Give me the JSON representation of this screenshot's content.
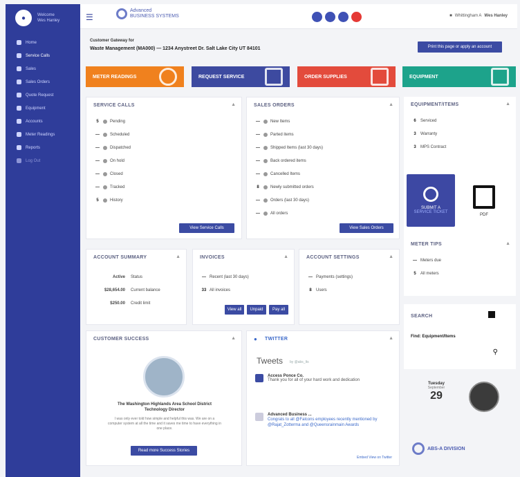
{
  "sidebar": {
    "user_line1": "Welcome",
    "user_line2": "Wes Hanley",
    "items": [
      {
        "label": "Home",
        "icon": "home-icon"
      },
      {
        "label": "Service Calls",
        "icon": "wrench-icon"
      },
      {
        "label": "Sales",
        "icon": "cart-icon"
      },
      {
        "label": "Sales Orders",
        "icon": "list-icon"
      },
      {
        "label": "Quote Request",
        "icon": "quote-icon"
      },
      {
        "label": "Equipment",
        "icon": "gear-icon"
      },
      {
        "label": "Accounts",
        "icon": "account-icon"
      },
      {
        "label": "Meter Readings",
        "icon": "meter-icon"
      },
      {
        "label": "Reports",
        "icon": "report-icon"
      },
      {
        "label": "Log Out",
        "icon": "logout-icon"
      }
    ]
  },
  "topbar": {
    "brand_line1": "Advanced",
    "brand_line2": "BUSINESS SYSTEMS",
    "account_text": "Whittingham A",
    "user_text": "Wes Hanley",
    "circles": [
      "#3f51b5",
      "#3f51b5",
      "#3f51b5",
      "#e53935"
    ]
  },
  "customer": {
    "label": "Customer Gateway for",
    "name": "Waste Management (MA000) — 1234 Anystreet Dr.   Salt Lake City UT 84101"
  },
  "apply_button": "Print this page or apply an account",
  "banners": [
    {
      "label": "METER READINGS",
      "color": "#f0811e"
    },
    {
      "label": "REQUEST SERVICE",
      "color": "#3d4aa0"
    },
    {
      "label": "ORDER SUPPLIES",
      "color": "#e34b3c"
    },
    {
      "label": "EQUIPMENT",
      "color": "#1da38b"
    }
  ],
  "service_calls": {
    "title": "SERVICE CALLS",
    "rows": [
      {
        "num": "5",
        "label": "Pending"
      },
      {
        "num": "—",
        "label": "Scheduled"
      },
      {
        "num": "—",
        "label": "Dispatched"
      },
      {
        "num": "—",
        "label": "On hold"
      },
      {
        "num": "—",
        "label": "Closed"
      },
      {
        "num": "—",
        "label": "Tracked"
      },
      {
        "num": "5",
        "label": "History"
      }
    ],
    "button": "View Service Calls"
  },
  "sales_orders": {
    "title": "SALES ORDERS",
    "rows": [
      {
        "num": "—",
        "label": "New Items"
      },
      {
        "num": "—",
        "label": "Parted items"
      },
      {
        "num": "—",
        "label": "Shipped Items (last 30 days)"
      },
      {
        "num": "—",
        "label": "Back ordered items"
      },
      {
        "num": "—",
        "label": "Cancelled Items"
      },
      {
        "num": "8",
        "label": "Newly submitted orders"
      },
      {
        "num": "—",
        "label": "Orders (last 30 days)"
      },
      {
        "num": "—",
        "label": "All orders"
      }
    ],
    "button": "View Sales Orders"
  },
  "equipment_panel": {
    "title": "EQUIPMENT/ITEMS",
    "rows": [
      {
        "num": "6",
        "label": "Serviced"
      },
      {
        "num": "3",
        "label": "Warranty"
      },
      {
        "num": "3",
        "label": "MPS Contract"
      }
    ]
  },
  "badge": {
    "line1": "SUBMIT A",
    "line2": "SERVICE TICKET"
  },
  "pdf_label": "PDF",
  "meter_tips": {
    "title": "METER TIPS",
    "rows": [
      {
        "num": "—",
        "label": "Meters due"
      },
      {
        "num": "5",
        "label": "All meters"
      }
    ]
  },
  "account_summary": {
    "title": "ACCOUNT SUMMARY",
    "rows": [
      {
        "left": "Active",
        "right": "Status"
      },
      {
        "left": "$28,654.00",
        "right": "Current balance"
      },
      {
        "left": "$250.00",
        "right": "Credit limit"
      }
    ]
  },
  "invoices": {
    "title": "INVOICES",
    "rows": [
      {
        "num": "—",
        "label": "Recent (last 30 days)"
      },
      {
        "num": "33",
        "label": "All invoices"
      }
    ],
    "buttons": [
      "View all",
      "Unpaid",
      "Pay all"
    ]
  },
  "account_settings": {
    "title": "ACCOUNT SETTINGS",
    "rows": [
      {
        "num": "—",
        "label": "Payments (settings)"
      },
      {
        "num": "8",
        "label": "Users"
      }
    ]
  },
  "search_panel": {
    "title": "SEARCH",
    "subtitle": "Find: Equipment/Items"
  },
  "customer_success": {
    "title": "CUSTOMER SUCCESS",
    "name": "The Washington Highlands Area School District Technology Director",
    "quote": "I was only ever told how simple and helpful this was. We are on a computer system at all the time and it saves me time to have everything in one place.",
    "button": "Read more Success Stories"
  },
  "twitter": {
    "title": "TWITTER",
    "heading": "Tweets",
    "by": "by @abs_lts",
    "tweet1_author": "Access Ponce Co.",
    "tweet1_text": "Thank you for all of your hard work and dedication",
    "tweet2_author": "Advanced Business ...",
    "tweet2_text": "Congrats to all @Falcons employees recently mentioned by @Rajat_Zotterma and @Queensrainmain Awards",
    "embed_link": "Embed View on Twitter"
  },
  "calendar": {
    "weekday": "Tuesday",
    "month": "September",
    "day": "29"
  },
  "footer_logo": "ABS-A DIVISION"
}
